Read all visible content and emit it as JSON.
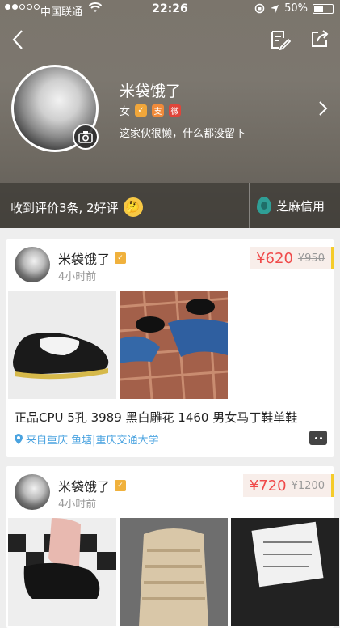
{
  "statusbar": {
    "carrier": "中国联通",
    "time": "22:26",
    "battery": "50%"
  },
  "profile": {
    "username": "米袋饿了",
    "gender": "女",
    "bio": "这家伙很懒，什么都没留下"
  },
  "rating": {
    "summary": "收到评价3条, 2好评",
    "credit_label": "芝麻信用"
  },
  "listings": [
    {
      "seller": "米袋饿了",
      "time": "4小时前",
      "price": "¥620",
      "original_price": "¥950",
      "title": "正品CPU 5孔 3989 黑白雕花 1460 男女马丁鞋单鞋",
      "location": "来自重庆 鱼塘|重庆交通大学"
    },
    {
      "seller": "米袋饿了",
      "time": "4小时前",
      "price": "¥720",
      "original_price": "¥1200"
    }
  ],
  "colors": {
    "accent_price": "#f04a4a",
    "location_blue": "#4aa3e0",
    "price_bar": "#f5cc2a"
  }
}
